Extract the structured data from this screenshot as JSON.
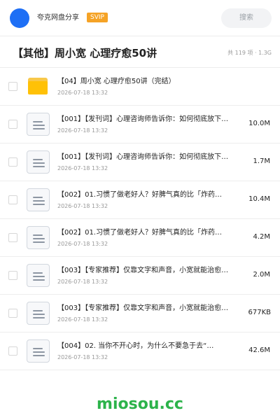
{
  "header": {
    "user_name": "夸克网盘分享",
    "vip_label": "SVIP",
    "search_placeholder": "搜索"
  },
  "folder": {
    "title": "【其他】周小宽 心理疗愈50讲",
    "count_label": "共 119 项 · 1.3G"
  },
  "files": [
    {
      "type": "folder",
      "name": "【04】周小宽 心理疗愈50讲（完结）",
      "date": "2026-07-18 13:32",
      "size": ""
    },
    {
      "type": "doc",
      "name": "【001】【发刊词】心理咨询师告诉你：如何彻底放下…",
      "date": "2026-07-18 13:32",
      "size": "10.0M"
    },
    {
      "type": "doc",
      "name": "【001】【发刊词】心理咨询师告诉你：如何彻底放下…",
      "date": "2026-07-18 13:32",
      "size": "1.7M"
    },
    {
      "type": "doc",
      "name": "【002】01.习惯了做老好人？好脾气真的比「炸药…",
      "date": "2026-07-18 13:32",
      "size": "10.4M"
    },
    {
      "type": "doc",
      "name": "【002】01.习惯了做老好人？好脾气真的比「炸药…",
      "date": "2026-07-18 13:32",
      "size": "4.2M"
    },
    {
      "type": "doc",
      "name": "【003】【专家推荐】仅靠文字和声音，小宽就能治愈…",
      "date": "2026-07-18 13:32",
      "size": "2.0M"
    },
    {
      "type": "doc",
      "name": "【003】【专家推荐】仅靠文字和声音，小宽就能治愈…",
      "date": "2026-07-18 13:32",
      "size": "677KB"
    },
    {
      "type": "doc",
      "name": "【004】02. 当你不开心时，为什么不要急于去“…",
      "date": "2026-07-18 13:32",
      "size": "42.6M"
    }
  ],
  "watermark": "miosou.cc",
  "colors": {
    "avatar": "#1e6ff5",
    "vip_badge": "#f5a326",
    "folder": "#ffc107",
    "watermark": "#2cb34a"
  }
}
